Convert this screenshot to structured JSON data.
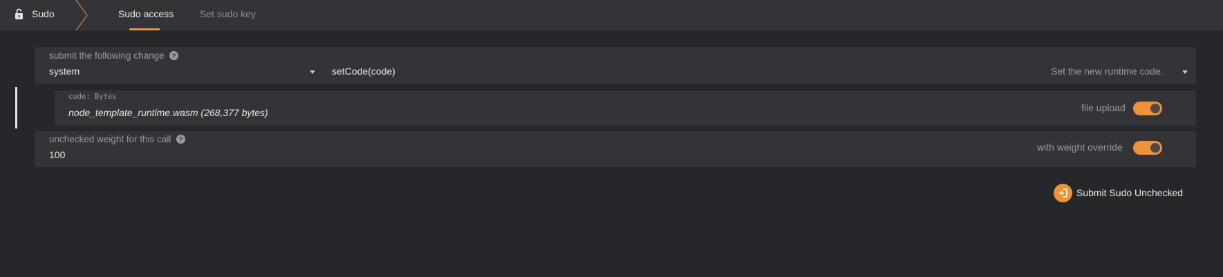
{
  "header": {
    "section_title": "Sudo",
    "tabs": [
      {
        "label": "Sudo access",
        "active": true
      },
      {
        "label": "Set sudo key",
        "active": false
      }
    ],
    "icons": {
      "lock": "unlock-icon"
    }
  },
  "change_panel": {
    "label": "submit the following change",
    "module_value": "system",
    "call_value": "setCode(code)",
    "call_description": "Set the new runtime code."
  },
  "code_panel": {
    "param_label": "code: Bytes",
    "file_value": "node_template_runtime.wasm (268,377 bytes)",
    "toggle_label": "file upload",
    "toggle_on": true
  },
  "weight_panel": {
    "label": "unchecked weight for this call",
    "value": "100",
    "toggle_label": "with weight override",
    "toggle_on": true
  },
  "submit": {
    "label": "Submit Sudo Unchecked"
  },
  "colors": {
    "accent": "#f19135",
    "background": "#26272b",
    "panel": "#333438"
  }
}
